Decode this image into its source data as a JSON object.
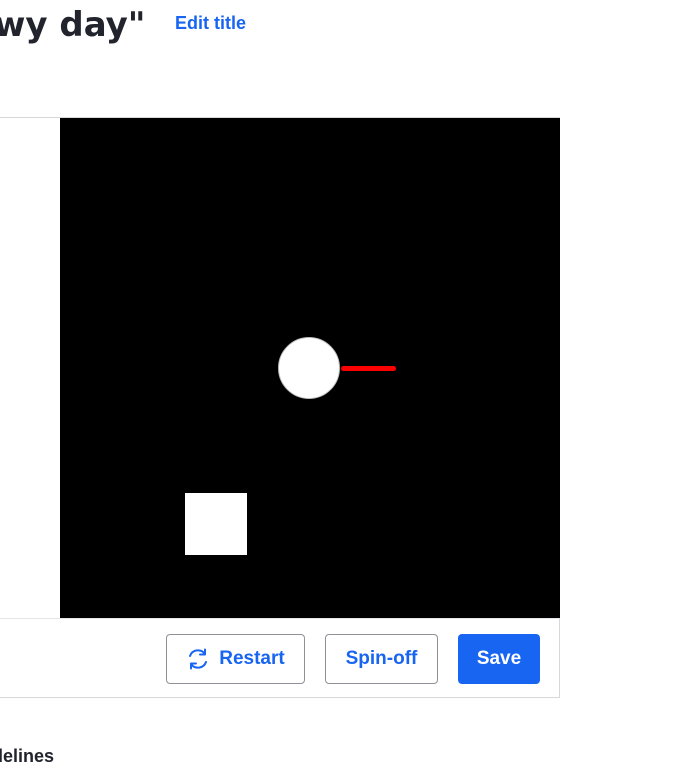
{
  "header": {
    "title": "wy day\"",
    "edit_title_label": "Edit title"
  },
  "toolbar": {
    "restart_label": "Restart",
    "restart_icon": "refresh-icon",
    "spinoff_label": "Spin-off",
    "save_label": "Save"
  },
  "footer": {
    "guidelines_label": "idelines"
  },
  "colors": {
    "accent": "#1865f2",
    "canvas_background": "#000000",
    "stick": "#ff0000",
    "shapes": "#ffffff"
  }
}
